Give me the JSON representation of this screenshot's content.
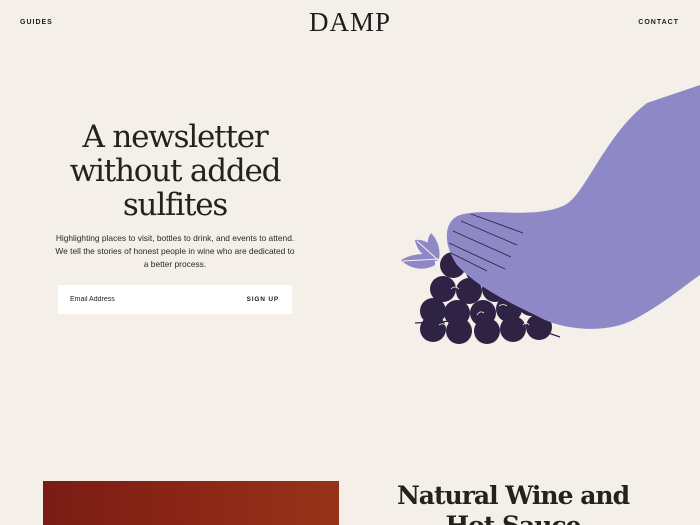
{
  "nav": {
    "left_label": "GUIDES",
    "right_label": "CONTACT",
    "logo_text": "DAMP"
  },
  "hero": {
    "title_lines": [
      "A newsletter",
      "without added",
      "sulfites"
    ],
    "description": "Highlighting places to visit, bottles to drink, and events to attend. We tell the stories of honest people in wine who are dedicated to a better process.",
    "email_placeholder": "Email Address",
    "signup_label": "SIGN UP"
  },
  "illustration": {
    "icon": "foot-stomping-grapes-illustration",
    "colors": {
      "foot": "#8e88c6",
      "grapes": "#2e2344",
      "leaf": "#8e88c6"
    }
  },
  "featured": {
    "title_lines": [
      "Natural Wine and",
      "Hot Sauce"
    ],
    "card_color": "#82211a"
  },
  "colors": {
    "background": "#f4efe8",
    "text": "#1f1d1b"
  }
}
